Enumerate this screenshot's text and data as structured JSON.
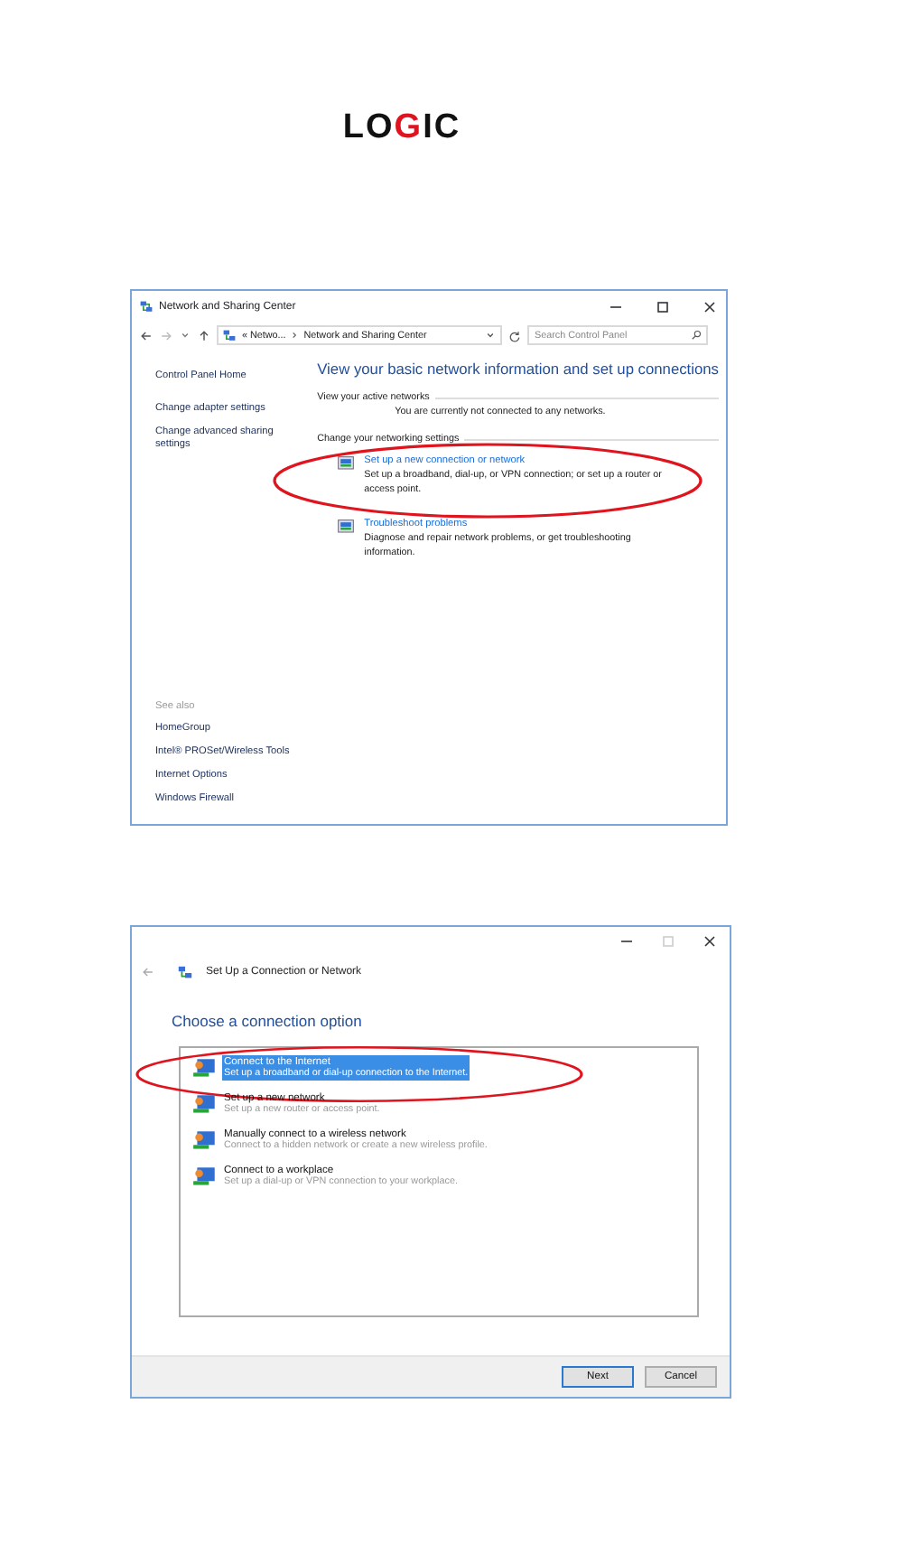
{
  "logo": {
    "parts": [
      "LO",
      "G",
      "IC"
    ]
  },
  "network_center": {
    "title": "Network and Sharing Center",
    "breadcrumb": [
      "« Netwo...",
      "Network and Sharing Center"
    ],
    "search": {
      "placeholder": "Search Control Panel"
    },
    "sidebar": {
      "items": [
        "Control Panel Home",
        "Change adapter settings",
        "Change advanced sharing settings"
      ],
      "see_also_heading": "See also",
      "see_also": [
        "HomeGroup",
        "Intel® PROSet/Wireless Tools",
        "Internet Options",
        "Windows Firewall"
      ]
    },
    "heading": "View your basic network information and set up connections",
    "active_networks_label": "View your active networks",
    "active_networks_status": "You are currently not connected to any networks.",
    "settings_label": "Change your networking settings",
    "tasks": [
      {
        "title": "Set up a new connection or network",
        "description": "Set up a broadband, dial-up, or VPN connection; or set up a router or access point.",
        "circled": true
      },
      {
        "title": "Troubleshoot problems",
        "description": "Diagnose and repair network problems, or get troubleshooting information.",
        "circled": false
      }
    ]
  },
  "setup_dialog": {
    "title": "Set Up a Connection or Network",
    "heading": "Choose a connection option",
    "options": [
      {
        "title": "Connect to the Internet",
        "description": "Set up a broadband or dial-up connection to the Internet.",
        "selected": true,
        "circled": true
      },
      {
        "title": "Set up a new network",
        "description": "Set up a new router or access point.",
        "selected": false,
        "circled": false
      },
      {
        "title": "Manually connect to a wireless network",
        "description": "Connect to a hidden network or create a new wireless profile.",
        "selected": false,
        "circled": false
      },
      {
        "title": "Connect to a workplace",
        "description": "Set up a dial-up or VPN connection to your workplace.",
        "selected": false,
        "circled": false
      }
    ],
    "buttons": [
      {
        "label": "Next",
        "kind": "default"
      },
      {
        "label": "Cancel",
        "kind": "normal"
      }
    ]
  }
}
